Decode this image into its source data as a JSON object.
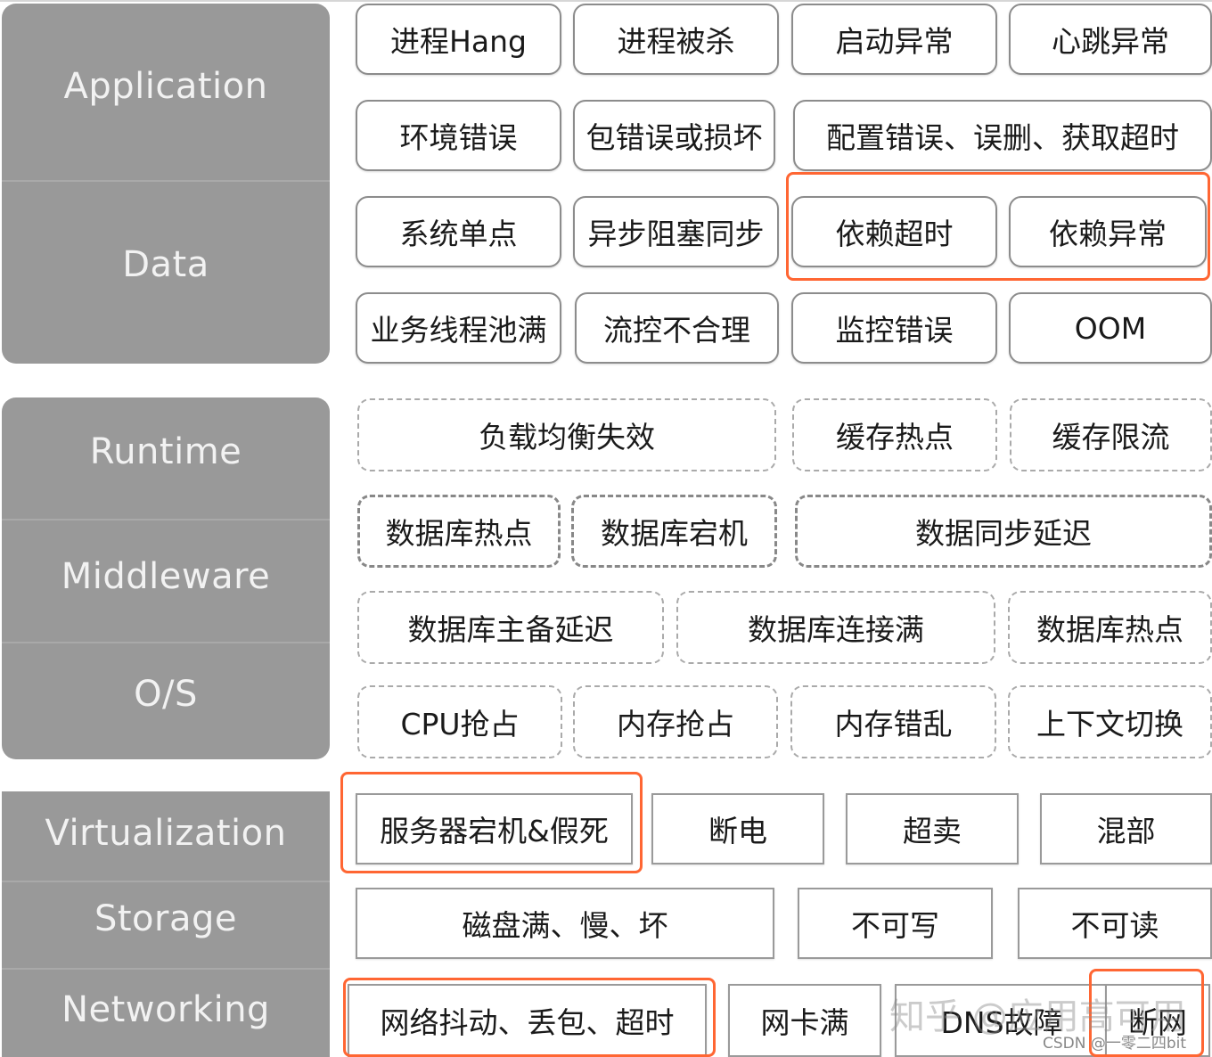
{
  "layers": {
    "group1": [
      "Application",
      "Data"
    ],
    "group2": [
      "Runtime",
      "Middleware",
      "O/S"
    ],
    "group3": [
      "Virtualization",
      "Storage",
      "Networking"
    ]
  },
  "application_data": {
    "row1": [
      "进程Hang",
      "进程被杀",
      "启动异常",
      "心跳异常"
    ],
    "row2": [
      "环境错误",
      "包错误或损坏",
      "配置错误、误删、获取超时"
    ],
    "row3": [
      "系统单点",
      "异步阻塞同步",
      "依赖超时",
      "依赖异常"
    ],
    "row4": [
      "业务线程池满",
      "流控不合理",
      "监控错误",
      "OOM"
    ]
  },
  "runtime_middleware_os": {
    "row1": [
      "负载均衡失效",
      "缓存热点",
      "缓存限流"
    ],
    "row2": [
      "数据库热点",
      "数据库宕机",
      "数据同步延迟"
    ],
    "row3": [
      "数据库主备延迟",
      "数据库连接满",
      "数据库热点"
    ],
    "row4": [
      "CPU抢占",
      "内存抢占",
      "内存错乱",
      "上下文切换"
    ]
  },
  "infrastructure": {
    "row1": [
      "服务器宕机&假死",
      "断电",
      "超卖",
      "混部"
    ],
    "row2": [
      "磁盘满、慢、坏",
      "不可写",
      "不可读"
    ],
    "row3": [
      "网络抖动、丢包、超时",
      "网卡满",
      "DNS故障",
      "断网"
    ]
  },
  "highlights": [
    "依赖超时 + 依赖异常",
    "服务器宕机&假死",
    "网络抖动、丢包、超时",
    "断网"
  ],
  "highlight_color": "#ff6633",
  "watermarks": {
    "zhihu": "知乎 @应用高可用",
    "csdn": "CSDN @一零二四bit"
  }
}
